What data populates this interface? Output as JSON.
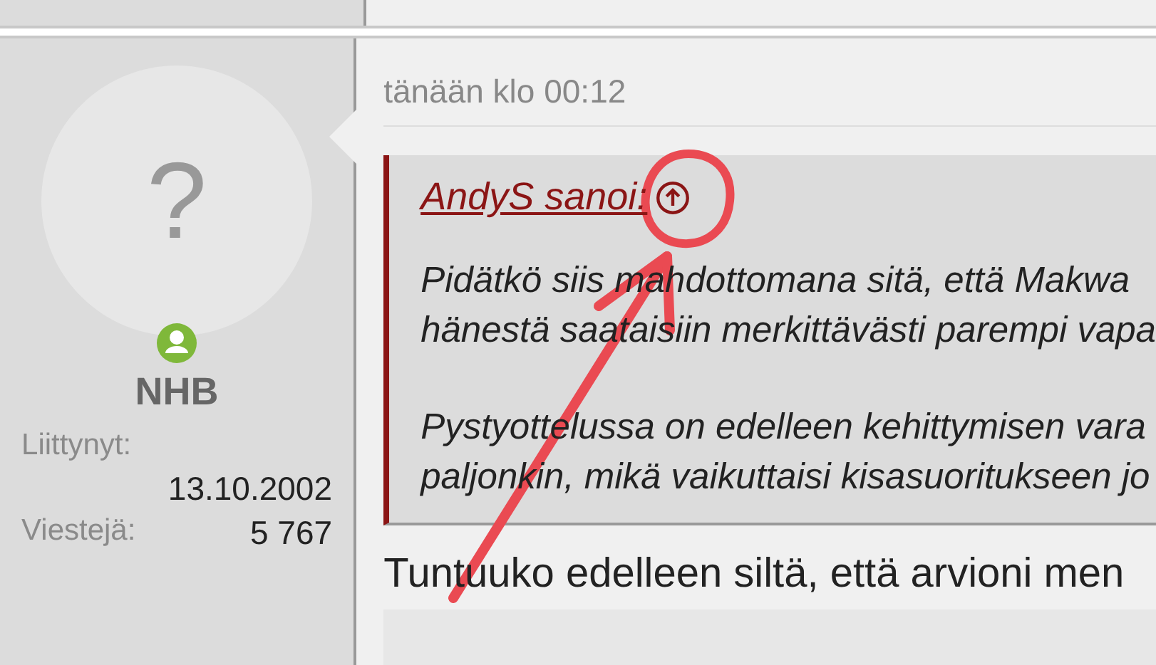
{
  "post": {
    "author": {
      "avatar": "?",
      "username": "NHB",
      "online": true,
      "stats": [
        {
          "label": "Liittynyt:",
          "value": "13.10.2002",
          "kind": "wrapped"
        },
        {
          "label": "Viestejä:",
          "value": "5 767",
          "kind": "inline"
        }
      ]
    },
    "timestamp": "tänään klo 00:12",
    "quote": {
      "attribution": "AndyS sanoi:",
      "paragraphs": [
        [
          "Pidätkö siis mahdottomana sitä, että Makwa",
          "hänestä saataisiin merkittävästi parempi vapa"
        ],
        [
          "Pystyottelussa on edelleen kehittymisen vara",
          "paljonkin, mikä vaikuttaisi kisasuoritukseen jo"
        ]
      ]
    },
    "body": "Tuntuuko edelleen siltä, että arvioni men"
  }
}
